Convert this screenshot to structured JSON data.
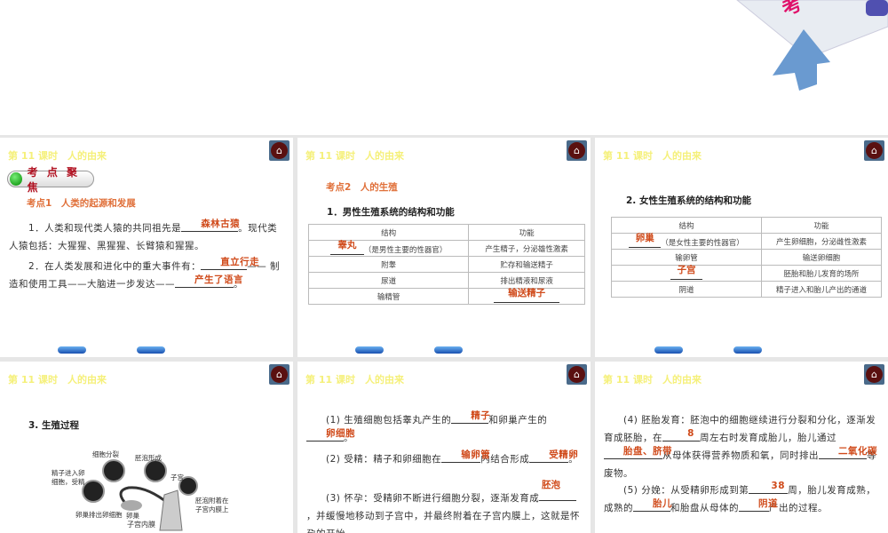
{
  "header_title": "第 11 课时　人的由来",
  "panel1": {
    "badge": "考 点 聚 焦",
    "topic": "考点1　人类的起源和发展",
    "p1a": "1．人类和现代类人猿的共同祖先是",
    "p1ans": "森林古猿",
    "p1b": "。现代类人猿包括：大猩猩、黑猩猩、长臂猿和猩猩。",
    "p2a": "2．在人类发展和进化中的重大事件有：",
    "p2ans1": "直立行走",
    "p2b": "—— 制造和使用工具——大脑进一步发达——",
    "p2ans2": "产生了语言",
    "p2c": "。"
  },
  "panel2": {
    "topic": "考点2　人的生殖",
    "heading": "1．男性生殖系统的结构和功能",
    "headers": [
      "结构",
      "功能"
    ],
    "rows": [
      {
        "ans": "睾丸",
        "s": "（是男性主要的性器官）",
        "f": "产生精子，分泌雄性激素"
      },
      {
        "s": "附睾",
        "f": "贮存和输送精子"
      },
      {
        "s": "尿道",
        "f": "排出精液和尿液"
      },
      {
        "s": "输精管",
        "fans": "输送精子"
      }
    ]
  },
  "panel3": {
    "heading": "2. 女性生殖系统的结构和功能",
    "headers": [
      "结构",
      "功能"
    ],
    "rows": [
      {
        "ans": "卵巢",
        "s": "（是女性主要的性器官）",
        "f": "产生卵细胞，分泌雌性激素"
      },
      {
        "s": "输卵管",
        "f": "输送卵细胞"
      },
      {
        "ans": "子宫",
        "f": "胚胎和胎儿发育的场所"
      },
      {
        "s": "阴道",
        "f": "精子进入和胎儿产出的通道"
      }
    ]
  },
  "panel4": {
    "heading": "3. 生殖过程",
    "labels": {
      "division": "细胞分裂",
      "blastocyst": "胚泡形成",
      "fert1": "精子进入卵",
      "fert2": "细胞，受精",
      "uterus": "子宫",
      "attach1": "胚泡附着在",
      "attach2": "子宫内膜上",
      "ovulate": "卵巢排出卵细胞",
      "ovary": "卵巢",
      "endometrium": "子宫内膜"
    }
  },
  "panel5": {
    "p1a": "(1) 生殖细胞包括睾丸产生的",
    "p1ans1": "精子",
    "p1b": "和卵巢产生的",
    "p1ans2": "卵细胞",
    "p1c": "。",
    "p2a": "(2) 受精：精子和卵细胞在",
    "p2ans1": "输卵管",
    "p2b": "内结合形成",
    "p2ans2": "受精卵",
    "p2c": "。",
    "p3ans": "胚泡",
    "p3a": "(3) 怀孕：受精卵不断进行细胞分裂，逐渐发育成",
    "p3b": "，并缓慢地移动到子宫中，并最终附着在子宫内膜上",
    "p3c": "，这就是怀孕的开始。"
  },
  "panel6": {
    "p4a": "(4) 胚胎发育：胚泡中的细胞继续进行分裂和分化，逐渐发育成胚胎，在",
    "p4ans1": "8",
    "p4b": "周左右时发育成胎儿，胎儿通过",
    "p4ans2": "胎盘、脐带",
    "p4c": "从母体获得营养物质和氧，同时排出",
    "p4ans3": "二氧化碳",
    "p4d": "等废物。",
    "p5a": "(5) 分娩：从受精卵形成到第",
    "p5ans1": "38",
    "p5b": "周，胎儿发育成熟，成熟的",
    "p5ans2": "胎儿",
    "p5c": "和胎盘从母体的",
    "p5ans3": "阴道",
    "p5d": "产出的过程。"
  },
  "logo_text": "考"
}
